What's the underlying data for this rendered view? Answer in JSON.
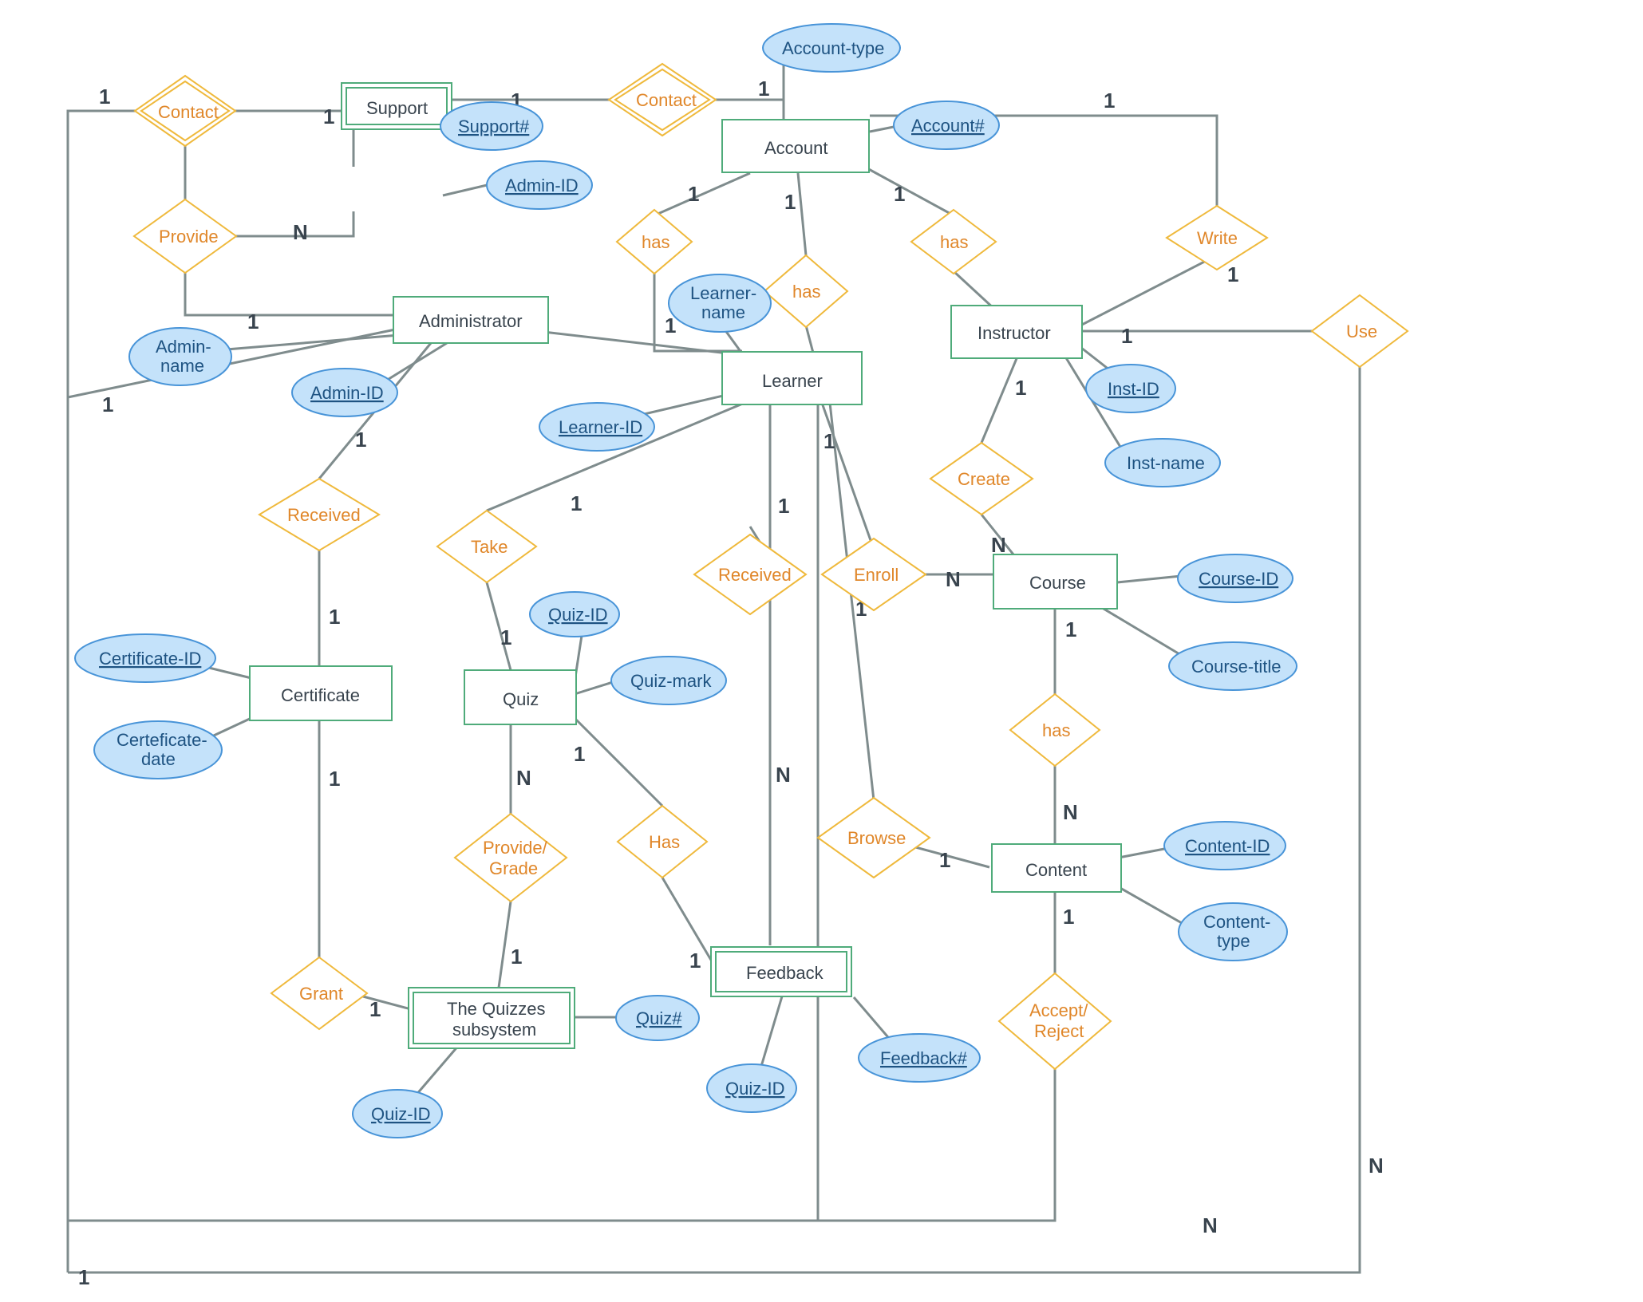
{
  "entities": {
    "support": "Support",
    "account": "Account",
    "administrator": "Administrator",
    "learner": "Learner",
    "instructor": "Instructor",
    "certificate": "Certificate",
    "quiz": "Quiz",
    "course": "Course",
    "content": "Content",
    "quizzes_subsystem_l1": "The Quizzes",
    "quizzes_subsystem_l2": "subsystem",
    "feedback": "Feedback"
  },
  "relationships": {
    "contact1": "Contact",
    "contact2": "Contact",
    "provide": "Provide",
    "has1": "has",
    "has2": "has",
    "has3": "has",
    "write": "Write",
    "use": "Use",
    "create": "Create",
    "enroll": "Enroll",
    "received1": "Received",
    "received2": "Received",
    "take": "Take",
    "has_course": "has",
    "browse": "Browse",
    "provide_grade_l1": "Provide/",
    "provide_grade_l2": "Grade",
    "has_quiz": "Has",
    "grant": "Grant",
    "accept_l1": "Accept/",
    "accept_l2": "Reject"
  },
  "attributes": {
    "support_no": "Support#",
    "admin_id_s": "Admin-ID",
    "account_type": "Account-type",
    "account_no": "Account#",
    "admin_name_l1": "Admin-",
    "admin_name_l2": "name",
    "admin_id_a": "Admin-ID",
    "learner_name_l1": "Learner-",
    "learner_name_l2": "name",
    "learner_id": "Learner-ID",
    "inst_id": "Inst-ID",
    "inst_name": "Inst-name",
    "certificate_id": "Certificate-ID",
    "certificate_date_l1": "Certeficate-",
    "certificate_date_l2": "date",
    "quiz_id": "Quiz-ID",
    "quiz_mark": "Quiz-mark",
    "course_id": "Course-ID",
    "course_title": "Course-title",
    "content_id": "Content-ID",
    "content_type_l1": "Content-",
    "content_type_l2": "type",
    "quiz_no": "Quiz#",
    "quiz_id2": "Quiz-ID",
    "feedback_no": "Feedback#",
    "quiz_id3": "Quiz-ID"
  },
  "card": {
    "one": "1",
    "n": "N"
  }
}
